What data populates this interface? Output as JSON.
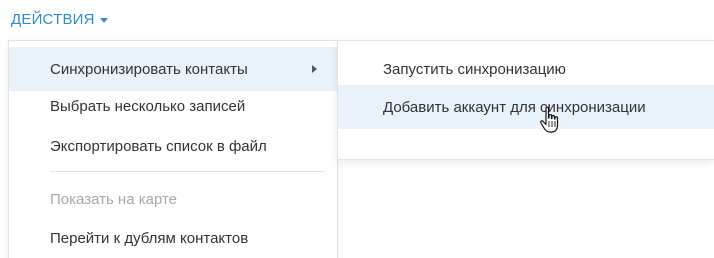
{
  "actions_button": {
    "label": "ДЕЙСТВИЯ",
    "icon": "caret-down-icon"
  },
  "menu": {
    "items": [
      {
        "label": "Синхронизировать контакты",
        "highlighted": true,
        "has_submenu": true,
        "enabled": true
      },
      {
        "label": "Выбрать несколько записей",
        "enabled": true
      },
      {
        "label": "Экспортировать список в файл",
        "enabled": true
      },
      {
        "label": "Показать на карте",
        "enabled": false
      },
      {
        "label": "Перейти к дублям контактов",
        "enabled": true
      }
    ]
  },
  "submenu": {
    "items": [
      {
        "label": "Запустить синхронизацию"
      },
      {
        "label": "Добавить аккаунт для синхронизации",
        "highlighted": true
      }
    ]
  },
  "colors": {
    "accent": "#2f8bcf",
    "highlight": "#e9f1fb",
    "text": "#333333",
    "disabled_text": "#a9a9a9"
  },
  "cursor": {
    "icon": "hand-pointer-icon"
  }
}
